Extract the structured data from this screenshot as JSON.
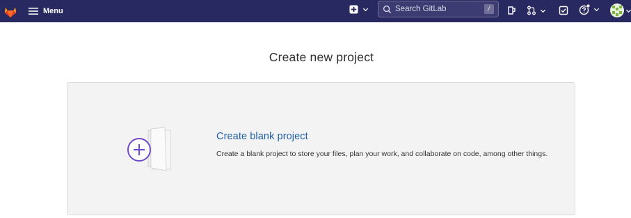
{
  "topbar": {
    "menu_label": "Menu",
    "search_placeholder": "Search GitLab",
    "search_shortcut": "/"
  },
  "page": {
    "title": "Create new project"
  },
  "card": {
    "title": "Create blank project",
    "description": "Create a blank project to store your files, plan your work, and collaborate on code, among other things."
  },
  "icons": [
    "gitlab-logo-icon",
    "hamburger-icon",
    "plus-square-icon",
    "chevron-down-icon",
    "search-icon",
    "issues-icon",
    "merge-request-icon",
    "todo-icon",
    "help-icon",
    "avatar"
  ],
  "colors": {
    "topbar": "#292961",
    "link": "#1f5fa7",
    "accent": "#6e49cb"
  }
}
